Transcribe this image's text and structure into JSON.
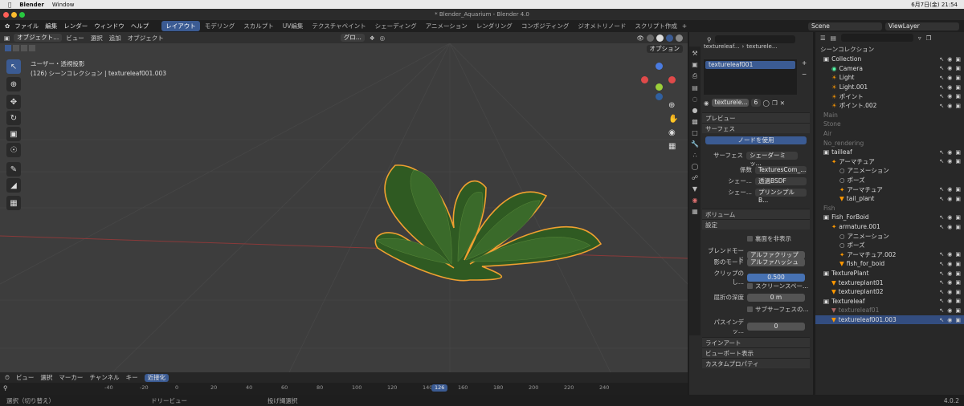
{
  "macbar": {
    "app": "Blender",
    "window": "Window",
    "date": "6月7日(金) 21:54"
  },
  "titlebar": {
    "title": "* Blender_Aquarium - Blender 4.0"
  },
  "topmenu": {
    "items": [
      "ファイル",
      "編集",
      "レンダー",
      "ウィンドウ",
      "ヘルプ"
    ]
  },
  "workspaces": [
    "レイアウト",
    "モデリング",
    "スカルプト",
    "UV編集",
    "テクスチャペイント",
    "シェーディング",
    "アニメーション",
    "レンダリング",
    "コンポジティング",
    "ジオメトリノード",
    "スクリプト作成"
  ],
  "scene": {
    "label": "Scene",
    "viewlayer": "ViewLayer"
  },
  "viewport_header": {
    "mode": "オブジェクト...",
    "items": [
      "ビュー",
      "選択",
      "追加",
      "オブジェクト"
    ],
    "transform": "グロ...",
    "options": "オプション"
  },
  "viewport": {
    "line1": "ユーザー・透視投影",
    "line2": "(126) シーンコレクション | textureleaf001.003"
  },
  "timeline": {
    "menu": [
      "ビュー",
      "選択",
      "マーカー",
      "チャンネル",
      "キー"
    ],
    "mode": "近接化",
    "frames": [
      "-40",
      "-20",
      "0",
      "20",
      "40",
      "60",
      "80",
      "100",
      "120",
      "140",
      "160",
      "180",
      "200",
      "220",
      "240"
    ],
    "current": "126"
  },
  "statusbar": {
    "select": "選択（切り替え）",
    "dolly": "ドリービュー",
    "lasso": "投げ縄選択",
    "version": "4.0.2"
  },
  "properties": {
    "breadcrumb1": "textureleaf...",
    "breadcrumb2": "texturele...",
    "slot": "textureleaf001",
    "material": "texturele...",
    "users": "6",
    "sections": {
      "preview": "プレビュー",
      "surface": "サーフェス",
      "volume": "ボリューム",
      "settings": "設定",
      "lineart": "ラインアート",
      "viewport_display": "ビューポート表示",
      "custom": "カスタムプロパティ"
    },
    "use_nodes": "ノードを使用",
    "surface_label": "サーフェス",
    "surface_value": "シェーダーミッ...",
    "factor_label": "係数",
    "factor_value": "TexturesCom_...",
    "shader1_label": "シェー...",
    "shader1_value": "透過BSDF",
    "shader2_label": "シェー...",
    "shader2_value": "プリンシプルB...",
    "backface": "裏面を非表示",
    "blend_label": "ブレンドモード",
    "blend_value": "アルファクリップ",
    "shadow_label": "影のモード",
    "shadow_value": "アルファハッシュ",
    "clip_label": "クリップのし...",
    "clip_value": "0.500",
    "screenspace": "スクリーンスペー...",
    "refraction_label": "屈折の深度",
    "refraction_value": "0 m",
    "subsurface": "サブサーフェスの...",
    "pass_label": "パスインデッ...",
    "pass_value": "0"
  },
  "outliner": {
    "title": "シーンコレクション",
    "rows": [
      {
        "label": "Collection",
        "indent": 1,
        "type": "coll"
      },
      {
        "label": "Camera",
        "indent": 2,
        "type": "cam"
      },
      {
        "label": "Light",
        "indent": 2,
        "type": "light"
      },
      {
        "label": "Light.001",
        "indent": 2,
        "type": "light"
      },
      {
        "label": "ポイント",
        "indent": 2,
        "type": "light"
      },
      {
        "label": "ポイント.002",
        "indent": 2,
        "type": "light"
      },
      {
        "label": "Main",
        "indent": 1,
        "type": "dim"
      },
      {
        "label": "Stone",
        "indent": 1,
        "type": "dim"
      },
      {
        "label": "Air",
        "indent": 1,
        "type": "dim"
      },
      {
        "label": "No_rendering",
        "indent": 1,
        "type": "dim"
      },
      {
        "label": "tailleaf",
        "indent": 1,
        "type": "coll"
      },
      {
        "label": "アーマチュア",
        "indent": 2,
        "type": "arm"
      },
      {
        "label": "アニメーション",
        "indent": 3,
        "type": "sub"
      },
      {
        "label": "ポーズ",
        "indent": 3,
        "type": "sub"
      },
      {
        "label": "アーマチュア",
        "indent": 3,
        "type": "arm"
      },
      {
        "label": "tail_plant",
        "indent": 3,
        "type": "mesh"
      },
      {
        "label": "Fish",
        "indent": 1,
        "type": "dim"
      },
      {
        "label": "Fish_ForBoid",
        "indent": 1,
        "type": "coll"
      },
      {
        "label": "armature.001",
        "indent": 2,
        "type": "arm"
      },
      {
        "label": "アニメーション",
        "indent": 3,
        "type": "sub"
      },
      {
        "label": "ポーズ",
        "indent": 3,
        "type": "sub"
      },
      {
        "label": "アーマチュア.002",
        "indent": 3,
        "type": "arm"
      },
      {
        "label": "fish_for_boid",
        "indent": 3,
        "type": "mesh"
      },
      {
        "label": "TexturePlant",
        "indent": 1,
        "type": "coll"
      },
      {
        "label": "textureplant01",
        "indent": 2,
        "type": "mesh"
      },
      {
        "label": "textureplant02",
        "indent": 2,
        "type": "mesh"
      },
      {
        "label": "Textureleaf",
        "indent": 1,
        "type": "coll"
      },
      {
        "label": "textureleaf01",
        "indent": 2,
        "type": "dimmesh"
      },
      {
        "label": "textureleaf001.003",
        "indent": 2,
        "type": "selmesh"
      }
    ]
  },
  "colors": {
    "accent": "#3b5b93",
    "select": "#334d80",
    "outline": "#f0a030",
    "leaf": "#3a6a2a"
  }
}
